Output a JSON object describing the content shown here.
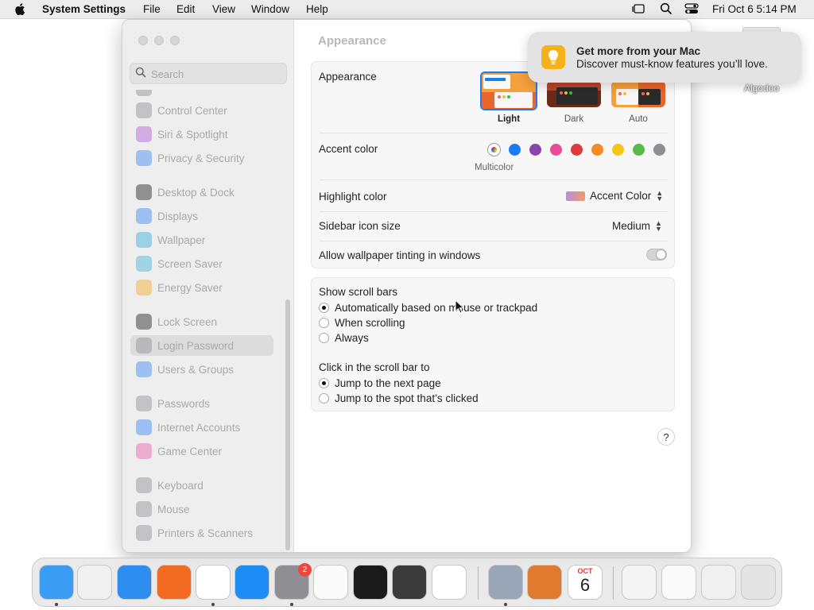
{
  "menubar": {
    "app_name": "System Settings",
    "menus": [
      "File",
      "Edit",
      "View",
      "Window",
      "Help"
    ],
    "clock": "Fri Oct 6  5:14 PM"
  },
  "desktop": {
    "item_label": "Algodoo"
  },
  "notification": {
    "title": "Get more from your Mac",
    "body": "Discover must-know features you’ll love."
  },
  "sidebar": {
    "search_placeholder": "Search",
    "items": [
      {
        "label": "Control Center",
        "icon": "control-center-icon",
        "color": "#8e8e93"
      },
      {
        "label": "Siri & Spotlight",
        "icon": "siri-icon",
        "color": "#b15ad8"
      },
      {
        "label": "Privacy & Security",
        "icon": "hand-icon",
        "color": "#3a86f5"
      },
      {
        "label": "Desktop & Dock",
        "icon": "dock-icon",
        "color": "#1c1c1e"
      },
      {
        "label": "Displays",
        "icon": "sun-icon",
        "color": "#3a86f5"
      },
      {
        "label": "Wallpaper",
        "icon": "wallpaper-icon",
        "color": "#35aadc"
      },
      {
        "label": "Screen Saver",
        "icon": "screen-saver-icon",
        "color": "#40b4d8"
      },
      {
        "label": "Energy Saver",
        "icon": "battery-icon",
        "color": "#f5a623"
      },
      {
        "label": "Lock Screen",
        "icon": "lock-icon",
        "color": "#1c1c1e"
      },
      {
        "label": "Login Password",
        "icon": "lock-icon",
        "color": "#8e8e93",
        "selected": true
      },
      {
        "label": "Users & Groups",
        "icon": "users-icon",
        "color": "#3a86f5"
      },
      {
        "label": "Passwords",
        "icon": "key-icon",
        "color": "#8e8e93"
      },
      {
        "label": "Internet Accounts",
        "icon": "at-icon",
        "color": "#3a86f5"
      },
      {
        "label": "Game Center",
        "icon": "game-center-icon",
        "color": "#e75fa8"
      },
      {
        "label": "Keyboard",
        "icon": "keyboard-icon",
        "color": "#8e8e93"
      },
      {
        "label": "Mouse",
        "icon": "mouse-icon",
        "color": "#8e8e93"
      },
      {
        "label": "Printers & Scanners",
        "icon": "printer-icon",
        "color": "#8e8e93"
      }
    ]
  },
  "content": {
    "title": "Appearance",
    "appearance": {
      "label": "Appearance",
      "options": [
        {
          "label": "Light",
          "selected": true
        },
        {
          "label": "Dark",
          "selected": false
        },
        {
          "label": "Auto",
          "selected": false
        }
      ]
    },
    "accent": {
      "label": "Accent color",
      "selected_caption": "Multicolor",
      "colors": [
        "multicolor",
        "#1a7cf5",
        "#8e44ad",
        "#ea4c9a",
        "#e0393e",
        "#f48a24",
        "#f5c518",
        "#5ab947",
        "#8e8e93"
      ]
    },
    "highlight": {
      "label": "Highlight color",
      "value": "Accent Color"
    },
    "sidebar_icon_size": {
      "label": "Sidebar icon size",
      "value": "Medium"
    },
    "wallpaper_tinting": {
      "label": "Allow wallpaper tinting in windows",
      "on": false
    },
    "scroll_bars": {
      "label": "Show scroll bars",
      "options": [
        {
          "label": "Automatically based on mouse or trackpad",
          "selected": true
        },
        {
          "label": "When scrolling",
          "selected": false
        },
        {
          "label": "Always",
          "selected": false
        }
      ]
    },
    "click_scroll": {
      "label": "Click in the scroll bar to",
      "options": [
        {
          "label": "Jump to the next page",
          "selected": true
        },
        {
          "label": "Jump to the spot that’s clicked",
          "selected": false
        }
      ]
    },
    "help": "?"
  },
  "dock": {
    "items": [
      {
        "name": "finder",
        "color": "#3b9cf3",
        "running": true
      },
      {
        "name": "launchpad",
        "color": "#f0f0f0",
        "running": false
      },
      {
        "name": "safari",
        "color": "#2e8ef0",
        "running": false
      },
      {
        "name": "firefox",
        "color": "#f26b21",
        "running": false
      },
      {
        "name": "chrome",
        "color": "#ffffff",
        "running": true
      },
      {
        "name": "app-store",
        "color": "#1e8cf5",
        "running": false
      },
      {
        "name": "system-settings",
        "color": "#8e8e93",
        "running": true,
        "badge": "2"
      },
      {
        "name": "textedit",
        "color": "#fafafa",
        "running": false
      },
      {
        "name": "terminal",
        "color": "#1a1a1a",
        "running": false
      },
      {
        "name": "garageband",
        "color": "#3a3a3a",
        "running": false
      },
      {
        "name": "vscode",
        "color": "#ffffff",
        "running": false
      },
      {
        "name": "algodoo",
        "color": "#9aa5b8",
        "running": true
      },
      {
        "name": "rocket-app",
        "color": "#e07a2e",
        "running": false
      },
      {
        "name": "calendar",
        "color": "#ffffff",
        "running": false,
        "month": "OCT",
        "day": "6"
      },
      {
        "name": "downloads-stack",
        "color": "#f5f5f5",
        "running": false
      },
      {
        "name": "document-stack",
        "color": "#fafafa",
        "running": false
      },
      {
        "name": "preview-stack",
        "color": "#f0f0f0",
        "running": false
      },
      {
        "name": "trash",
        "color": "#e4e4e4",
        "running": false
      }
    ]
  }
}
